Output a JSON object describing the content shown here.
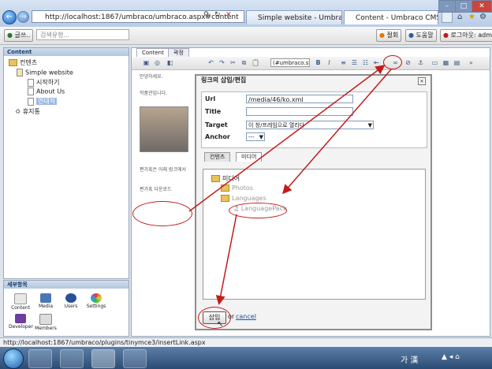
{
  "browser": {
    "address_url": "http://localhost:1867/umbraco/umbraco.aspx#content",
    "tabs": [
      "Simple website - Umbraco C...",
      "Content - Umbraco CMS - ..."
    ]
  },
  "umbraco_toolbar": {
    "create_label": "글쓰..",
    "search_placeholder": "검색유형...",
    "help_label": "절회",
    "help2_label": "도움말",
    "logout_label": "로그아웃: admin"
  },
  "tree": {
    "header": "Content",
    "root": "컨텐츠",
    "site": "Simple website",
    "items": [
      "시작하기",
      "About Us",
      "연대적"
    ],
    "recycle": "휴지통"
  },
  "sections": {
    "header": "세부항목",
    "items": [
      "Content",
      "Media",
      "Users",
      "Settings",
      "Developer",
      "Members"
    ]
  },
  "editor": {
    "tabs": [
      "Content",
      "곽정"
    ],
    "style_dropdown": "(#umbraco.st",
    "content_lines": [
      "안녕하세요.",
      "작품관입니다.",
      "편가혹은 아래 링크에서",
      "편가혹 다운로드"
    ]
  },
  "dialog": {
    "title": "링크의 삽입/편집",
    "url_label": "Url",
    "url_value": "/media/46/ko.xml",
    "title_label": "Title",
    "title_value": "",
    "target_label": "Target",
    "target_value": "이 창/프레임으로 열리다",
    "anchor_label": "Anchor",
    "anchor_value": "---",
    "tabs": [
      "컨텐츠",
      "미디어"
    ],
    "media_root": "미디어",
    "media_folders": [
      "Photos",
      "Languages"
    ],
    "media_file": "LanguagePack",
    "insert_label": "삽입",
    "or_text": "or",
    "cancel_label": "cancel"
  },
  "status_bar": {
    "text": "http://localhost:1867/umbraco/plugins/tinymce3/insertLink.aspx"
  },
  "taskbar": {
    "ime_text": "가 漢"
  },
  "colors": {
    "annotation": "#c21b1b",
    "folder": "#e9c25c"
  }
}
